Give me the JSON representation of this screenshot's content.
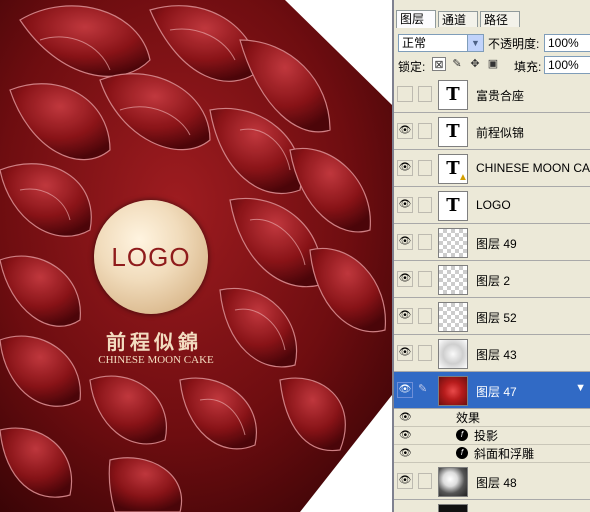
{
  "canvas": {
    "logo_text": "LOGO",
    "brand_cn": "前程似錦",
    "brand_en": "CHINESE MOON CAKE",
    "colors": {
      "background": "#7a0f13",
      "petal_dark": "#3d0508",
      "petal_highlight": "#c8434a",
      "logo_gold": "#e8cba4"
    }
  },
  "panel": {
    "tabs": [
      {
        "label": "图层",
        "active": true
      },
      {
        "label": "通道",
        "active": false
      },
      {
        "label": "路径",
        "active": false
      }
    ],
    "blend_mode": "正常",
    "opacity_label": "不透明度:",
    "opacity_value": "100%",
    "lock_label": "锁定:",
    "fill_label": "填充:",
    "fill_value": "100%",
    "layers": [
      {
        "name": "富贵合座",
        "thumb": "text",
        "visible": false,
        "selected": false
      },
      {
        "name": "前程似锦",
        "thumb": "text",
        "visible": true,
        "selected": false
      },
      {
        "name": "CHINESE MOON CAKE",
        "thumb": "text",
        "visible": true,
        "selected": false,
        "warning": true
      },
      {
        "name": "LOGO",
        "thumb": "text",
        "visible": true,
        "selected": false
      },
      {
        "name": "图层 49",
        "thumb": "checker",
        "visible": true,
        "selected": false
      },
      {
        "name": "图层 2",
        "thumb": "checker",
        "visible": true,
        "selected": false
      },
      {
        "name": "图层 52",
        "thumb": "checker",
        "visible": true,
        "selected": false
      },
      {
        "name": "图层 43",
        "thumb": "mono",
        "visible": true,
        "selected": false
      },
      {
        "name": "图层 47",
        "thumb": "red",
        "visible": true,
        "selected": true,
        "has_effects": true
      }
    ],
    "effects": {
      "header": "效果",
      "items": [
        "投影",
        "斜面和浮雕"
      ]
    },
    "bottom_layer": {
      "name": "图层 48",
      "thumb": "bw",
      "visible": true
    },
    "icons": {
      "eye": "eye-icon",
      "text_layer": "text-layer-icon",
      "warning": "warning-icon",
      "brush": "brush-icon",
      "fx": "fx-icon",
      "lock_transparent": "lock-transparent-icon",
      "lock_paint": "lock-paint-icon",
      "lock_move": "lock-move-icon",
      "lock_all": "lock-all-icon"
    }
  }
}
